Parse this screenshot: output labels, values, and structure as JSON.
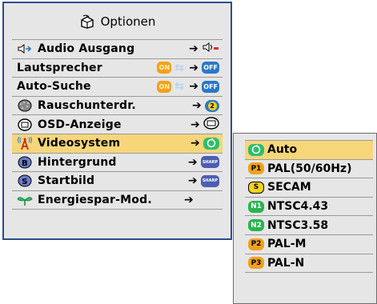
{
  "menu": {
    "title": "Optionen",
    "items": [
      {
        "label": "Audio Ausgang",
        "icon": "speaker-out-icon",
        "value_type": "icon"
      },
      {
        "label": "Lautsprecher",
        "icon": "",
        "value_type": "toggle",
        "from": "ON",
        "to": "OFF"
      },
      {
        "label": "Auto-Suche",
        "icon": "",
        "value_type": "toggle",
        "from": "ON",
        "to": "OFF"
      },
      {
        "label": "Rauschunterdr.",
        "icon": "noise-icon",
        "value_type": "icon"
      },
      {
        "label": "OSD-Anzeige",
        "icon": "osd-icon",
        "value_type": "icon"
      },
      {
        "label": "Videosystem",
        "icon": "antenna-icon",
        "value_type": "icon",
        "selected": true
      },
      {
        "label": "Hintergrund",
        "icon": "b-icon",
        "value_type": "sharp"
      },
      {
        "label": "Startbild",
        "icon": "s-icon",
        "value_type": "sharp"
      },
      {
        "label": "Energiespar-Mod.",
        "icon": "leaf-icon",
        "value_type": "arrow"
      }
    ],
    "sharp_text": "SHARP",
    "rausch_value": "2"
  },
  "submenu": {
    "items": [
      {
        "badge": "auto-icon",
        "badge_text": "",
        "label": "Auto",
        "selected": true
      },
      {
        "badge": "p1-badge",
        "badge_text": "P1",
        "label": "PAL(50/60Hz)"
      },
      {
        "badge": "s-badge",
        "badge_text": "S",
        "label": "SECAM"
      },
      {
        "badge": "n1-badge",
        "badge_text": "N1",
        "label": "NTSC4.43"
      },
      {
        "badge": "n2-badge",
        "badge_text": "N2",
        "label": "NTSC3.58"
      },
      {
        "badge": "p2-badge",
        "badge_text": "P2",
        "label": "PAL-M"
      },
      {
        "badge": "p3-badge",
        "badge_text": "P3",
        "label": "PAL-N"
      }
    ]
  },
  "colors": {
    "panel_bg": "#e6e6e6",
    "panel_border": "#2a4d8f",
    "selected_row": "#f7d67a",
    "on_pill": "#f2a11c",
    "off_pill": "#2a78c8"
  }
}
